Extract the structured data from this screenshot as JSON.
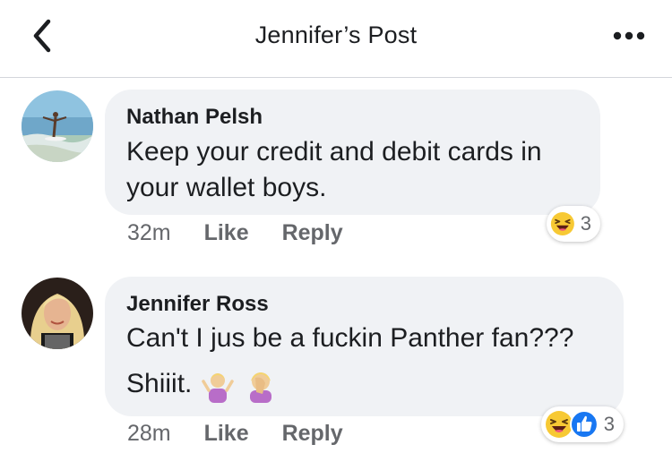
{
  "header": {
    "title": "Jennifer’s Post"
  },
  "comments": [
    {
      "author": "Nathan Pelsh",
      "text_line1": "Keep your credit and debit cards in",
      "text_line2": "your wallet boys.",
      "time": "32m",
      "like_label": "Like",
      "reply_label": "Reply",
      "reaction_count": "3",
      "reactions": [
        "laughing-emoji"
      ]
    },
    {
      "author": "Jennifer Ross",
      "text_line1": "Can't I jus be a fuckin Panther fan???",
      "text_line2": "Shiiit.",
      "emojis": [
        "person-shrugging-emoji",
        "face-palm-emoji"
      ],
      "time": "28m",
      "like_label": "Like",
      "reply_label": "Reply",
      "reaction_count": "3",
      "reactions": [
        "laughing-emoji",
        "like-emoji"
      ]
    }
  ],
  "colors": {
    "bubble": "#f0f2f5",
    "like_blue": "#1877f2",
    "meta_gray": "#65676b"
  }
}
